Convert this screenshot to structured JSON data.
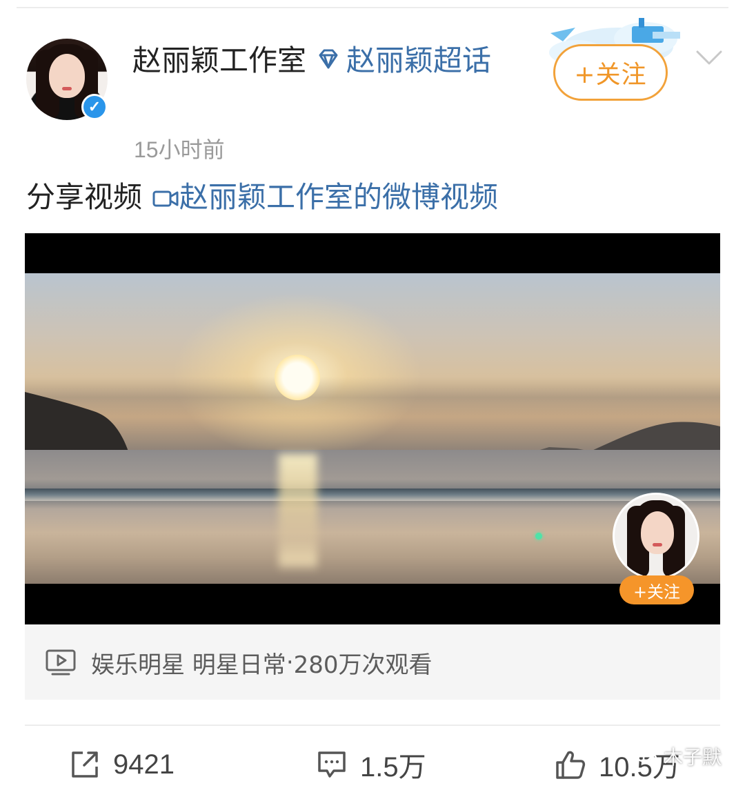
{
  "post": {
    "author_name": "赵丽颖工作室",
    "topic_link": "赵丽颖超话",
    "timestamp": "15小时前",
    "follow_label": "+关注",
    "share_prefix": "分享视频",
    "share_link": "赵丽颖工作室的微博视频"
  },
  "video": {
    "follow_label": "+关注",
    "category": "娱乐明星 明星日常",
    "views": "280万次观看",
    "separator": " · "
  },
  "actions": {
    "repost_count": "9421",
    "comment_count": "1.5万",
    "like_count": "10.5万"
  },
  "watermark": {
    "text": "木子默"
  },
  "colors": {
    "accent_orange": "#f2a23a",
    "link_blue": "#3b6fa8",
    "verified_blue": "#2a95ea"
  },
  "icons": {
    "verified": "verified-badge-icon",
    "topic": "diamond-icon",
    "video_link": "video-camera-icon",
    "meta": "play-screen-icon",
    "repost": "share-arrow-icon",
    "comment": "comment-bubble-icon",
    "like": "thumbs-up-icon",
    "more": "chevron-down-icon"
  }
}
